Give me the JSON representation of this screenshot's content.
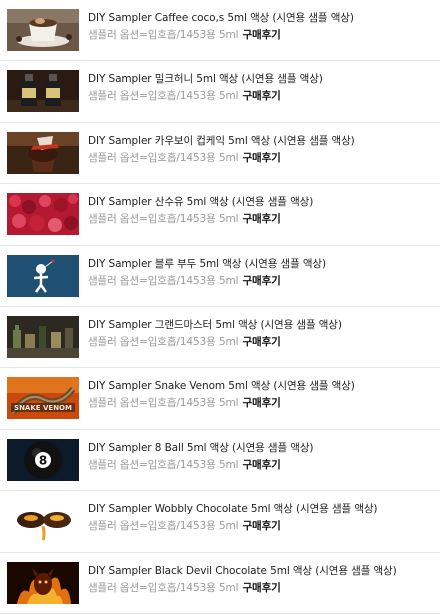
{
  "products": [
    {
      "name": "DIY Sampler Caffee coco,s 5ml 액상 (시연용 샘플 액상)",
      "option": "샘플러 옵션=입호흡/1453용 5ml",
      "review": "구매후기",
      "thumb_icon": "coffee-cup-thumbnail"
    },
    {
      "name": "DIY Sampler 밀크허니 5ml 액상 (시연용 샘플 액상)",
      "option": "샘플러 옵션=입호흡/1453용 5ml",
      "review": "구매후기",
      "thumb_icon": "liquid-bottles-thumbnail"
    },
    {
      "name": "DIY Sampler 카우보이 컵케익 5ml 액상 (시연용 샘플 액상)",
      "option": "샘플러 옵션=입호흡/1453용 5ml",
      "review": "구매후기",
      "thumb_icon": "cupcake-thumbnail"
    },
    {
      "name": "DIY Sampler 산수유 5ml 액상 (시연용 샘플 액상)",
      "option": "샘플러 옵션=입호흡/1453용 5ml",
      "review": "구매후기",
      "thumb_icon": "red-berries-thumbnail"
    },
    {
      "name": "DIY Sampler 블루 부두 5ml 액상 (시연용 샘플 액상)",
      "option": "샘플러 옵션=입호흡/1453용 5ml",
      "review": "구매후기",
      "thumb_icon": "voodoo-doll-thumbnail"
    },
    {
      "name": "DIY Sampler 그랜드마스터 5ml 액상 (시연용 샘플 액상)",
      "option": "샘플러 옵션=입호흡/1453용 5ml",
      "review": "구매후기",
      "thumb_icon": "shelf-bottles-thumbnail"
    },
    {
      "name": "DIY Sampler Snake Venom 5ml 액상 (시연용 샘플 액상)",
      "option": "샘플러 옵션=입호흡/1453용 5ml",
      "review": "구매후기",
      "thumb_icon": "snake-venom-thumbnail",
      "thumb_text": "SNAKE VENOM"
    },
    {
      "name": "DIY Sampler 8 Ball 5ml 액상 (시연용 샘플 액상)",
      "option": "샘플러 옵션=입호흡/1453용 5ml",
      "review": "구매후기",
      "thumb_icon": "eight-ball-thumbnail",
      "thumb_text": "8"
    },
    {
      "name": "DIY Sampler Wobbly Chocolate 5ml 액상 (시연용 샘플 액상)",
      "option": "샘플러 옵션=입호흡/1453용 5ml",
      "review": "구매후기",
      "thumb_icon": "chocolate-thumbnail"
    },
    {
      "name": "DIY Sampler Black Devil Chocolate 5ml 액상 (시연용 샘플 액상)",
      "option": "샘플러 옵션=입호흡/1453용 5ml",
      "review": "구매후기",
      "thumb_icon": "devil-fire-thumbnail"
    }
  ]
}
